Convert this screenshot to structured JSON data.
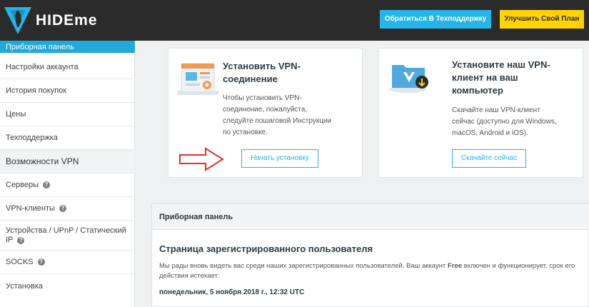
{
  "header": {
    "logo_text": "HIDEme",
    "support_label": "Обратиться В Техподдержку",
    "upgrade_label": "Улучшить Свой План"
  },
  "sidebar": {
    "items": [
      {
        "label": "Приборная панель",
        "active": true
      },
      {
        "label": "Настройки аккаунта"
      },
      {
        "label": "История покупок"
      },
      {
        "label": "Цены"
      },
      {
        "label": "Техподдержка"
      },
      {
        "label": "Возможности VPN",
        "section": true
      },
      {
        "label": "Серверы",
        "help": true
      },
      {
        "label": "VPN-клиенты",
        "help": true
      },
      {
        "label": "Устройства / UPnP / Статический IP",
        "help": true
      },
      {
        "label": "SOCKS",
        "help": true
      },
      {
        "label": "Установка"
      }
    ]
  },
  "cards": {
    "install_vpn": {
      "title_line1": "Установить VPN-",
      "title_line2": "соединение",
      "desc_lines": [
        "Чтобы установить VPN-",
        "соединение, пожалуйста,",
        "следуйте пошаговой Инструкции",
        "по установке."
      ],
      "button": "Начать установку"
    },
    "install_client": {
      "title_line1": "Установите наш VPN-",
      "title_line2": "клиент на ваш",
      "title_line3": "компьютер",
      "desc_lines": [
        "Скачайте наш VPN-клиент",
        "сейчас (доступно для Windows,",
        "macOS, Android и iOS)."
      ],
      "button": "Скачайте сейчас"
    }
  },
  "dashboard": {
    "header": "Приборная панель",
    "title": "Страница зарегистрированного пользователя",
    "text_before": "Мы рады вновь видеть вас среди наших зарегистрированных пользователей. Ваш аккаунт ",
    "plan": "Free",
    "text_after": " включен и функционирует, срок его действия истекает:",
    "date": "понедельник, 5 ноября 2018 г., 12:32 UTC"
  },
  "colors": {
    "accent": "#23b6e8",
    "upgrade": "#ffd400",
    "header_bg": "#2b2b2b",
    "arrow": "#e0302a"
  },
  "icons": {
    "help": "help-circle-icon",
    "arrow": "arrow-right-icon"
  }
}
